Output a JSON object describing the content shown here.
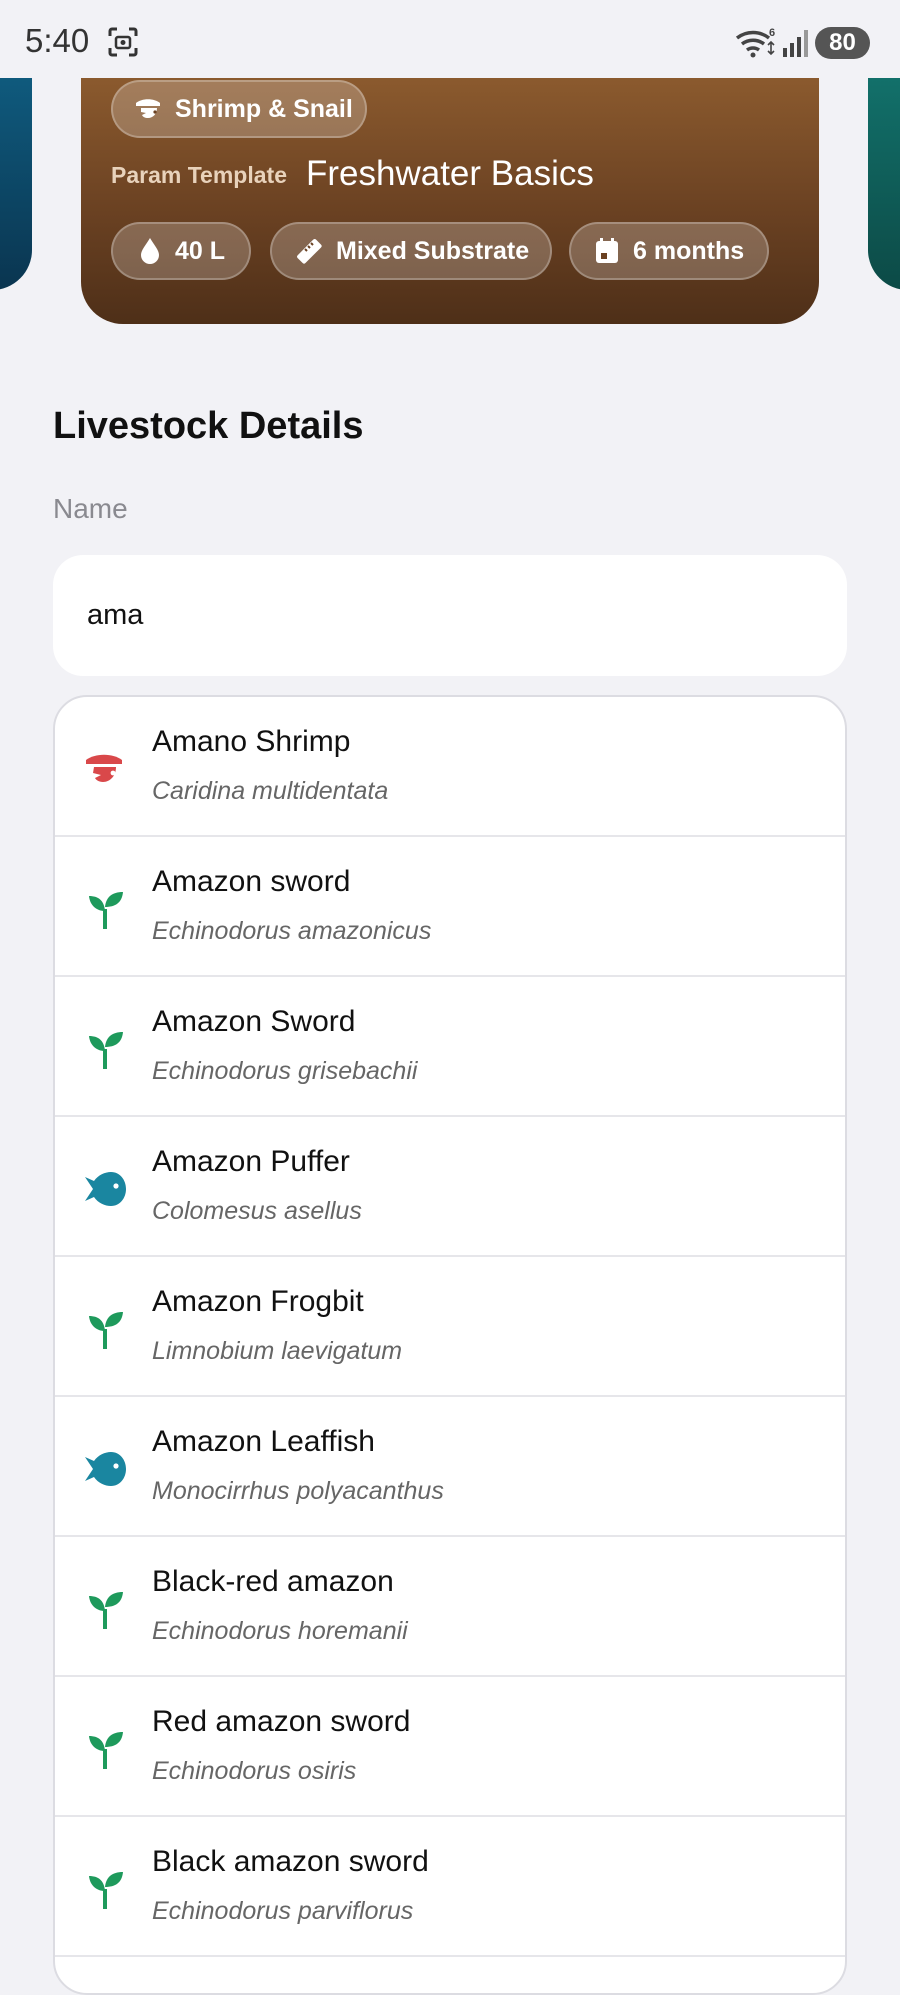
{
  "status_bar": {
    "time": "5:40",
    "battery": "80"
  },
  "tank": {
    "type_chip": "Shrimp & Snail",
    "param_label": "Param Template",
    "param_value": "Freshwater Basics",
    "volume": "40 L",
    "substrate": "Mixed Substrate",
    "age": "6 months"
  },
  "details": {
    "title": "Livestock Details",
    "name_label": "Name",
    "name_value": "ama"
  },
  "colors": {
    "shrimp": "#d9484a",
    "plant": "#1e9a5c",
    "fish": "#1a86a0"
  },
  "results": [
    {
      "name": "Amano Shrimp",
      "scientific": "Caridina multidentata",
      "icon": "shrimp-icon"
    },
    {
      "name": "Amazon sword",
      "scientific": "Echinodorus amazonicus",
      "icon": "plant-icon"
    },
    {
      "name": "Amazon Sword",
      "scientific": "Echinodorus grisebachii",
      "icon": "plant-icon"
    },
    {
      "name": "Amazon Puffer",
      "scientific": "Colomesus asellus",
      "icon": "fish-icon"
    },
    {
      "name": "Amazon Frogbit",
      "scientific": "Limnobium laevigatum",
      "icon": "plant-icon"
    },
    {
      "name": "Amazon Leaffish",
      "scientific": "Monocirrhus polyacanthus",
      "icon": "fish-icon"
    },
    {
      "name": "Black-red amazon",
      "scientific": "Echinodorus horemanii",
      "icon": "plant-icon"
    },
    {
      "name": "Red amazon sword",
      "scientific": "Echinodorus osiris",
      "icon": "plant-icon"
    },
    {
      "name": "Black amazon sword",
      "scientific": "Echinodorus parviflorus",
      "icon": "plant-icon"
    }
  ]
}
